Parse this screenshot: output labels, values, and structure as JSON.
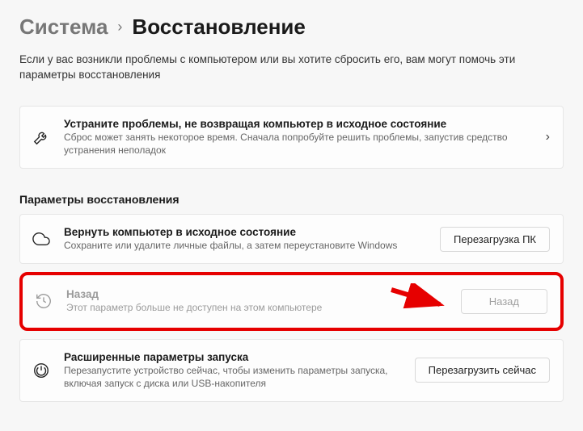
{
  "breadcrumb": {
    "parent": "Система",
    "current": "Восстановление"
  },
  "description": "Если у вас возникли проблемы с компьютером или вы хотите сбросить его, вам могут помочь эти параметры восстановления",
  "troubleshoot": {
    "title": "Устраните проблемы, не возвращая компьютер в исходное состояние",
    "sub": "Сброс может занять некоторое время. Сначала попробуйте решить проблемы, запустив средство устранения неполадок"
  },
  "section_title": "Параметры восстановления",
  "reset": {
    "title": "Вернуть компьютер в исходное состояние",
    "sub": "Сохраните или удалите личные файлы, а затем переустановите Windows",
    "button": "Перезагрузка ПК"
  },
  "goback": {
    "title": "Назад",
    "sub": "Этот параметр больше не доступен на этом компьютере",
    "button": "Назад"
  },
  "advanced": {
    "title": "Расширенные параметры запуска",
    "sub": "Перезапустите устройство сейчас, чтобы изменить параметры запуска, включая запуск с диска или USB-накопителя",
    "button": "Перезагрузить сейчас"
  }
}
